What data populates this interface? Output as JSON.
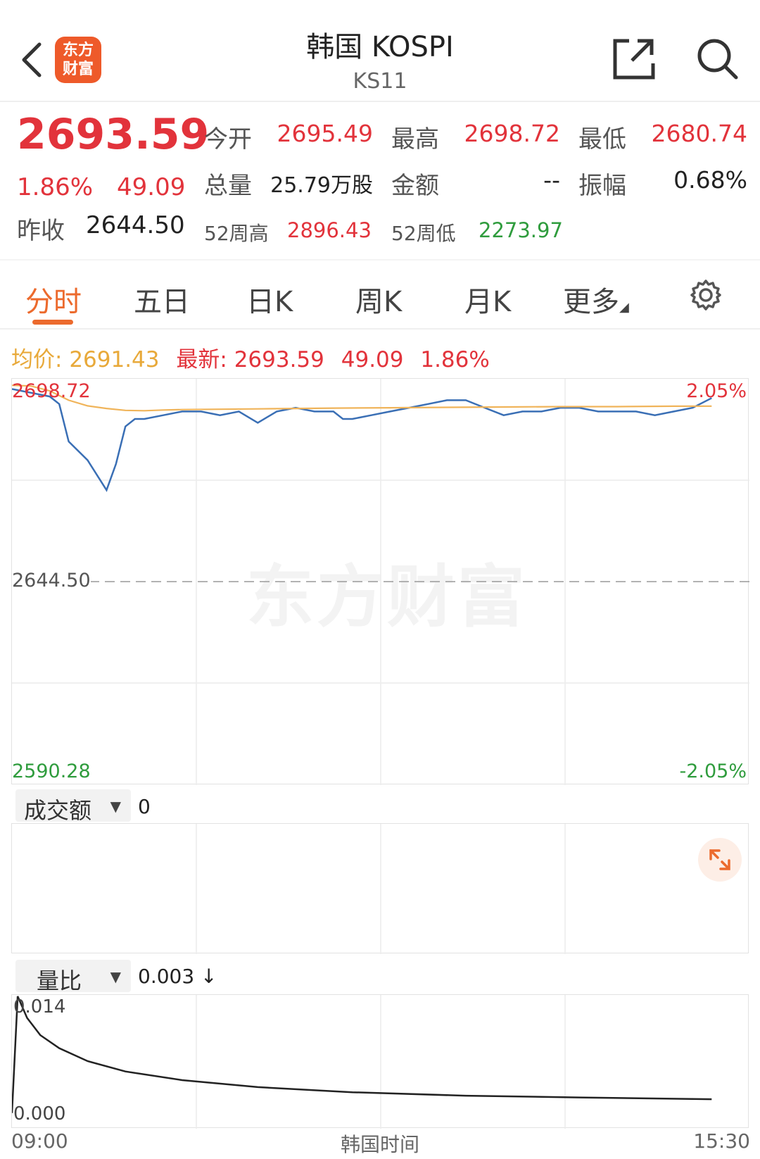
{
  "header": {
    "title": "韩国 KOSPI",
    "subtitle": "KS11",
    "logo_text_line1": "东方",
    "logo_text_line2": "财富"
  },
  "quote": {
    "price": "2693.59",
    "change_pct": "1.86%",
    "change": "49.09",
    "prev_close_label": "昨收",
    "prev_close": "2644.50",
    "open_label": "今开",
    "open": "2695.49",
    "high_label": "最高",
    "high": "2698.72",
    "low_label": "最低",
    "low": "2680.74",
    "volume_label": "总量",
    "volume": "25.79万股",
    "amount_label": "金额",
    "amount": "--",
    "amplitude_label": "振幅",
    "amplitude": "0.68%",
    "wk52_high_label": "52周高",
    "wk52_high": "2896.43",
    "wk52_low_label": "52周低",
    "wk52_low": "2273.97"
  },
  "tabs": [
    "分时",
    "五日",
    "日K",
    "周K",
    "月K",
    "更多"
  ],
  "active_tab": "分时",
  "info_line": {
    "avg_label": "均价:",
    "avg": "2691.43",
    "latest_label": "最新:",
    "latest": "2693.59",
    "change": "49.09",
    "change_pct": "1.86%"
  },
  "chart_data": {
    "type": "line",
    "y_top_label": "2698.72",
    "y_mid_label": "2644.50",
    "y_bottom_label": "2590.28",
    "pct_top_label": "2.05%",
    "pct_bottom_label": "-2.05%",
    "x_start": "09:00",
    "x_end": "15:30",
    "x_axis_title": "韩国时间",
    "ylim": [
      2590.28,
      2698.72
    ],
    "x_range_minutes": [
      0,
      390
    ],
    "series": [
      {
        "color": "#3a6fb5",
        "x": [
          0,
          10,
          20,
          25,
          30,
          40,
          50,
          55,
          60,
          65,
          70,
          80,
          90,
          100,
          110,
          120,
          130,
          140,
          150,
          160,
          170,
          175,
          180,
          190,
          200,
          210,
          220,
          230,
          240,
          250,
          260,
          270,
          280,
          290,
          300,
          310,
          320,
          330,
          340,
          350,
          360,
          370
        ],
        "y": [
          2696,
          2695,
          2694,
          2692,
          2682,
          2677,
          2669,
          2676,
          2686,
          2688,
          2688,
          2689,
          2690,
          2690,
          2689,
          2690,
          2687,
          2690,
          2691,
          2690,
          2690,
          2688,
          2688,
          2689,
          2690,
          2691,
          2692,
          2693,
          2693,
          2691,
          2689,
          2690,
          2690,
          2691,
          2691,
          2690,
          2690,
          2690,
          2689,
          2690,
          2691,
          2693.59
        ]
      },
      {
        "color": "#f0b45a",
        "x": [
          0,
          10,
          20,
          30,
          40,
          50,
          60,
          70,
          80,
          90,
          110,
          130,
          150,
          170,
          200,
          230,
          260,
          290,
          320,
          350,
          370
        ],
        "y": [
          2697,
          2696.8,
          2695.5,
          2693,
          2691.5,
          2690.8,
          2690.3,
          2690.2,
          2690.4,
          2690.5,
          2690.6,
          2690.7,
          2690.8,
          2690.9,
          2691.0,
          2691.1,
          2691.2,
          2691.3,
          2691.3,
          2691.4,
          2691.43
        ]
      }
    ]
  },
  "volume_panel": {
    "selector": "成交额",
    "value": "0"
  },
  "ratio_panel": {
    "selector": "量比",
    "value": "0.003 ↓",
    "top_label": "0.014",
    "bottom_label": "0.000",
    "chart_data": {
      "type": "line",
      "ylim": [
        0.0,
        0.014
      ],
      "x": [
        0,
        3,
        8,
        15,
        25,
        40,
        60,
        90,
        130,
        180,
        240,
        300,
        370
      ],
      "y": [
        0.001,
        0.0145,
        0.012,
        0.01,
        0.0085,
        0.007,
        0.0058,
        0.0048,
        0.004,
        0.0034,
        0.003,
        0.0028,
        0.0026
      ]
    }
  },
  "watermark": "东方财富"
}
